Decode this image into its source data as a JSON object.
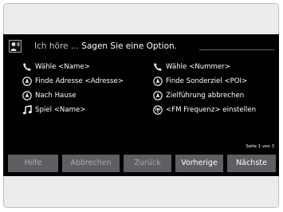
{
  "header": {
    "prompt_dim": "Ich höre ... ",
    "prompt_strong": "Sagen Sie eine Option."
  },
  "commands": [
    {
      "icon": "phone-icon",
      "label": "Wähle <Name>"
    },
    {
      "icon": "phone-icon",
      "label": "Wähle <Nummer>"
    },
    {
      "icon": "navigation-icon",
      "label": "Finde Adresse <Adresse>"
    },
    {
      "icon": "navigation-icon",
      "label": "Finde Sonderziel <POI>"
    },
    {
      "icon": "navigation-icon",
      "label": "Nach Hause"
    },
    {
      "icon": "navigation-icon",
      "label": "Zielführung abbrechen"
    },
    {
      "icon": "music-note-icon",
      "label": "Spiel <Name>"
    },
    {
      "icon": "radio-icon",
      "label": "<FM Frequenz> einstellen"
    }
  ],
  "pagination": {
    "label": "Seite 1 von 3"
  },
  "buttons": {
    "help": "Hilfe",
    "cancel": "Abbrechen",
    "back": "Zurück",
    "previous": "Vorherige",
    "next": "Nächste"
  }
}
